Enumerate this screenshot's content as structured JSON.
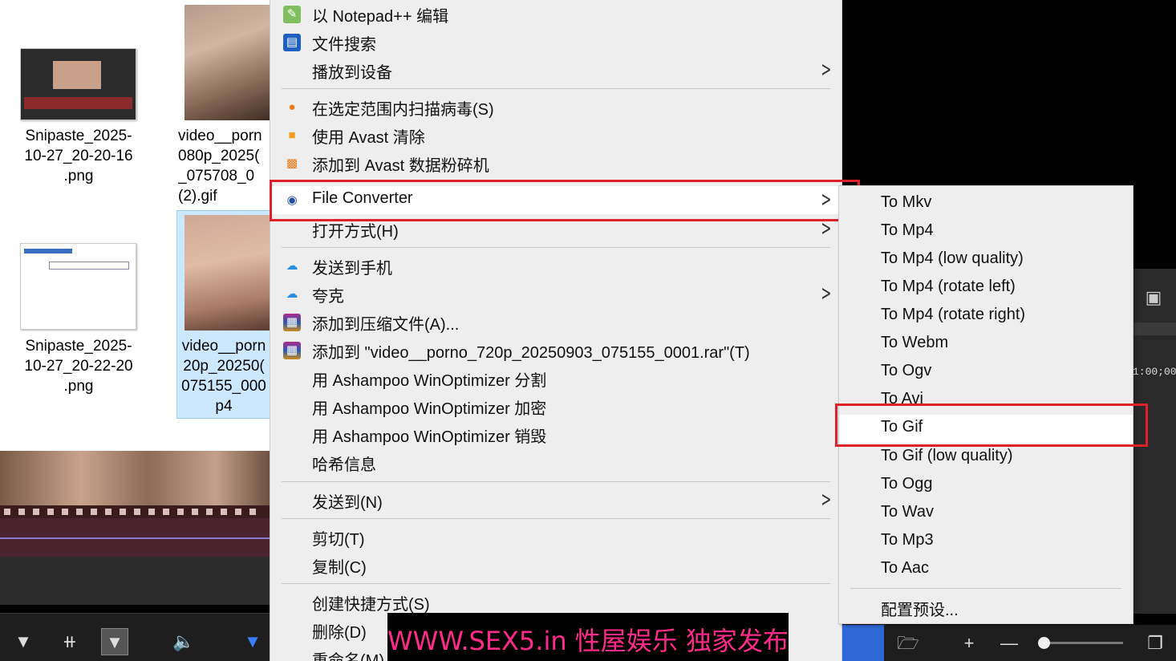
{
  "explorer": {
    "files": [
      {
        "name": "Snipaste_2025-\n10-27_20-20-16\n.png"
      },
      {
        "name": "video__porn\n080p_2025(\n_075708_0\n(2).gif"
      },
      {
        "name": "Snipaste_2025-\n10-27_20-22-20\n.png"
      },
      {
        "name": "video__porn\n20p_20250(\n075155_000\np4"
      }
    ]
  },
  "context_menu": {
    "items": [
      {
        "label": "以 Notepad++ 编辑",
        "icon": "notepad-icon"
      },
      {
        "label": "文件搜索",
        "icon": "search-window-icon"
      },
      {
        "label": "播放到设备",
        "submenu": true
      },
      {
        "label": "在选定范围内扫描病毒(S)",
        "icon": "avast-icon"
      },
      {
        "label": "使用 Avast 清除",
        "icon": "avast-clean-icon"
      },
      {
        "label": "添加到 Avast 数据粉碎机",
        "icon": "avast-shredder-icon"
      },
      {
        "label": "File Converter",
        "icon": "file-converter-icon",
        "submenu": true
      },
      {
        "label": "打开方式(H)",
        "submenu": true
      },
      {
        "label": "发送到手机",
        "icon": "cloud-icon"
      },
      {
        "label": "夸克",
        "icon": "cloud-icon",
        "submenu": true
      },
      {
        "label": "添加到压缩文件(A)...",
        "icon": "winrar-icon"
      },
      {
        "label": "添加到 \"video__porno_720p_20250903_075155_0001.rar\"(T)",
        "icon": "winrar-icon"
      },
      {
        "label": "用 Ashampoo WinOptimizer 分割"
      },
      {
        "label": "用 Ashampoo WinOptimizer 加密"
      },
      {
        "label": "用 Ashampoo WinOptimizer 销毁"
      },
      {
        "label": "哈希信息"
      },
      {
        "label": "发送到(N)",
        "submenu": true
      },
      {
        "label": "剪切(T)"
      },
      {
        "label": "复制(C)"
      },
      {
        "label": "创建快捷方式(S)"
      },
      {
        "label": "删除(D)"
      },
      {
        "label": "重命名(M)"
      }
    ]
  },
  "submenu": {
    "items": [
      "To Mkv",
      "To Mp4",
      "To Mp4 (low quality)",
      "To Mp4 (rotate left)",
      "To Mp4 (rotate right)",
      "To Webm",
      "To Ogv",
      "To Avi",
      "To Gif",
      "To Gif (low quality)",
      "To Ogg",
      "To Wav",
      "To Mp3",
      "To Aac"
    ],
    "settings": "配置预设..."
  },
  "editor": {
    "timecode": "1:00;00"
  },
  "watermark": "WWW.SEX5.in 性屋娱乐 独家发布",
  "colors": {
    "menu_bg": "#eeeeee",
    "highlight_box": "#e0202a",
    "watermark": "#ff2a8a",
    "accent_blue": "#2f67d6"
  }
}
